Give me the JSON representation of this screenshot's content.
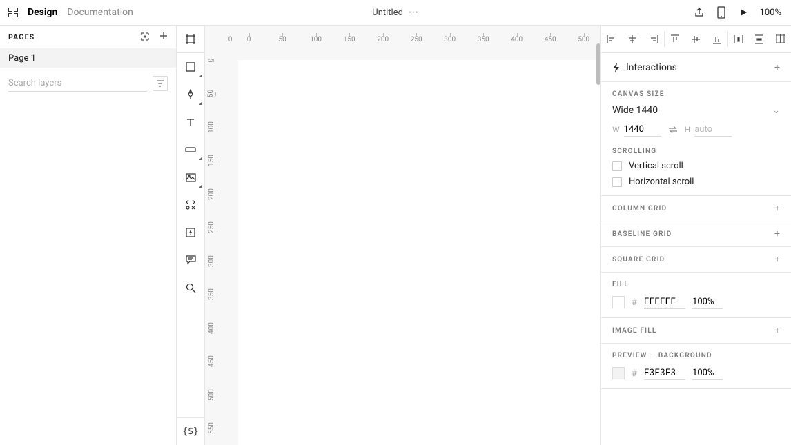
{
  "header": {
    "tabs": {
      "design": "Design",
      "documentation": "Documentation"
    },
    "title": "Untitled",
    "zoom": "100%"
  },
  "left": {
    "pages_label": "PAGES",
    "page_name": "Page 1",
    "search_placeholder": "Search layers"
  },
  "ruler": {
    "h": [
      "0",
      "0",
      "50",
      "100",
      "150",
      "200",
      "250",
      "300",
      "350",
      "400",
      "450",
      "500"
    ],
    "v": [
      "0",
      "50",
      "100",
      "150",
      "200",
      "250",
      "300",
      "350",
      "400",
      "450",
      "500",
      "550"
    ]
  },
  "right": {
    "interactions_label": "Interactions",
    "canvas_size_label": "CANVAS SIZE",
    "canvas_size_value": "Wide 1440",
    "w_label": "W",
    "w_value": "1440",
    "h_label": "H",
    "h_placeholder": "auto",
    "scrolling_label": "SCROLLING",
    "vertical_scroll": "Vertical scroll",
    "horizontal_scroll": "Horizontal scroll",
    "column_grid": "COLUMN GRID",
    "baseline_grid": "BASELINE GRID",
    "square_grid": "SQUARE GRID",
    "fill_label": "FILL",
    "fill_hex": "FFFFFF",
    "fill_opacity": "100%",
    "image_fill": "IMAGE FILL",
    "preview_bg_label": "PREVIEW — BACKGROUND",
    "preview_hex": "F3F3F3",
    "preview_opacity": "100%"
  }
}
